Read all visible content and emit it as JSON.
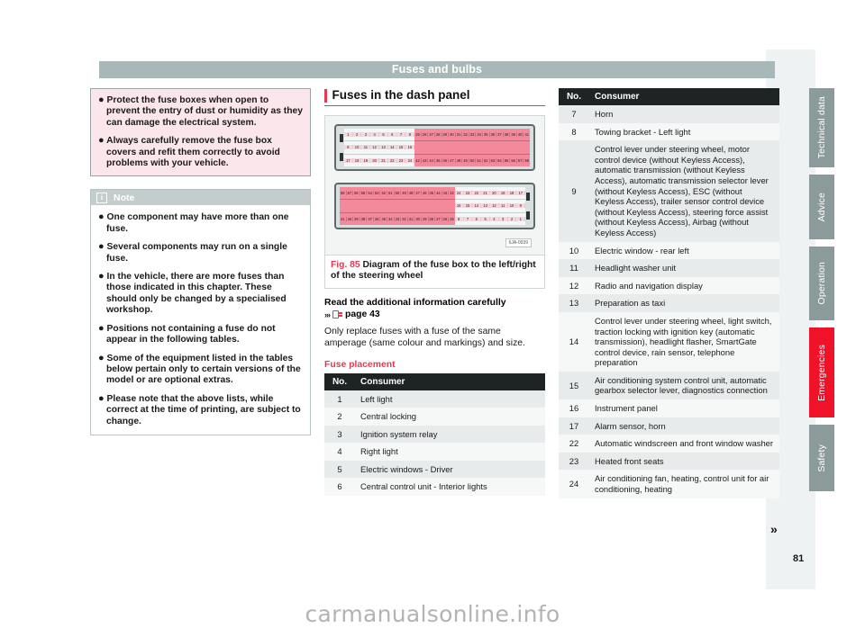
{
  "header": {
    "chapter_title": "Fuses and bulbs"
  },
  "warning": {
    "items": [
      "Protect the fuse boxes when open to prevent the entry of dust or humidity as they can damage the electrical system.",
      "Always carefully remove the fuse box covers and refit them correctly to avoid problems with your vehicle."
    ]
  },
  "note": {
    "icon": "info-icon",
    "title": "Note",
    "items": [
      "One component may have more than one fuse.",
      "Several components may run on a single fuse.",
      "In the vehicle, there are more fuses than those indicated in this chapter. These should only be changed by a specialised workshop.",
      "Positions not containing a fuse do not appear in the following tables.",
      "Some of the equipment listed in the tables below pertain only to certain versions of the model or are optional extras.",
      "Please note that the above lists, while correct at the time of printing, are subject to change."
    ]
  },
  "middle": {
    "section_title": "Fuses in the dash panel",
    "figure": {
      "id_code": "6JA-0039",
      "fig_number": "Fig. 85",
      "caption": "Diagram of the fuse box to the left/right of the steering wheel",
      "box_top": {
        "white_rows": [
          [
            "1",
            "2",
            "3",
            "4",
            "5",
            "6",
            "7",
            "8"
          ],
          [
            "9",
            "10",
            "11",
            "12",
            "13",
            "14",
            "15",
            "16"
          ],
          [
            "17",
            "18",
            "19",
            "20",
            "21",
            "22",
            "23",
            "24"
          ]
        ],
        "pink_rows": [
          [
            "25",
            "26",
            "27",
            "28",
            "29",
            "30",
            "31",
            "32",
            "33",
            "34",
            "35",
            "36",
            "37",
            "38",
            "39",
            "40",
            "41"
          ],
          [
            "",
            "",
            "",
            "",
            "",
            "",
            "",
            "",
            "",
            "",
            "",
            "",
            "",
            "",
            "",
            "",
            ""
          ],
          [
            "42",
            "43",
            "44",
            "45",
            "46",
            "47",
            "48",
            "49",
            "50",
            "51",
            "52",
            "53",
            "54",
            "55",
            "56",
            "57",
            "58"
          ]
        ]
      },
      "box_bottom": {
        "pink_rows": [
          [
            "58",
            "57",
            "56",
            "55",
            "54",
            "53",
            "52",
            "51",
            "50",
            "49",
            "48",
            "47",
            "46",
            "45",
            "44",
            "43",
            "42"
          ],
          [
            "",
            "",
            "",
            "",
            "",
            "",
            "",
            "",
            "",
            "",
            "",
            "",
            "",
            "",
            "",
            "",
            ""
          ],
          [
            "41",
            "40",
            "39",
            "38",
            "37",
            "36",
            "35",
            "34",
            "33",
            "32",
            "31",
            "30",
            "29",
            "28",
            "27",
            "26",
            "25"
          ]
        ],
        "white_rows": [
          [
            "24",
            "23",
            "22",
            "21",
            "20",
            "19",
            "18",
            "17"
          ],
          [
            "16",
            "15",
            "14",
            "13",
            "12",
            "11",
            "10",
            "9"
          ],
          [
            "8",
            "7",
            "6",
            "5",
            "4",
            "3",
            "2",
            "1"
          ]
        ]
      }
    },
    "read_heading": "Read the additional information carefully",
    "reference": {
      "chevron": "»›",
      "icon": "book-page-icon",
      "page_label": "page 43"
    },
    "paragraph": "Only replace fuses with a fuse of the same amperage (same colour and markings) and size.",
    "sub_heading": "Fuse placement",
    "table": {
      "columns": [
        "No.",
        "Consumer"
      ],
      "rows": [
        {
          "no": "1",
          "consumer": "Left light"
        },
        {
          "no": "2",
          "consumer": "Central locking"
        },
        {
          "no": "3",
          "consumer": "Ignition system relay"
        },
        {
          "no": "4",
          "consumer": "Right light"
        },
        {
          "no": "5",
          "consumer": "Electric windows - Driver"
        },
        {
          "no": "6",
          "consumer": "Central control unit - Interior lights"
        }
      ]
    }
  },
  "right": {
    "table": {
      "columns": [
        "No.",
        "Consumer"
      ],
      "rows": [
        {
          "no": "7",
          "consumer": "Horn"
        },
        {
          "no": "8",
          "consumer": "Towing bracket - Left light"
        },
        {
          "no": "9",
          "consumer": "Control lever under steering wheel, motor control device (without Keyless Access), automatic transmission (without Keyless Access), automatic transmission selector lever (without Keyless Access), ESC (without Keyless Access), trailer sensor control device (without Keyless Access), steering force assist (without Keyless Access), Airbag (without Keyless Access)"
        },
        {
          "no": "10",
          "consumer": "Electric window - rear left"
        },
        {
          "no": "11",
          "consumer": "Headlight washer unit"
        },
        {
          "no": "12",
          "consumer": "Radio and navigation display"
        },
        {
          "no": "13",
          "consumer": "Preparation as taxi"
        },
        {
          "no": "14",
          "consumer": "Control lever under steering wheel, light switch, traction locking with ignition key (automatic transmission), headlight flasher, SmartGate control device, rain sensor, telephone preparation"
        },
        {
          "no": "15",
          "consumer": "Air conditioning system control unit, automatic gearbox selector lever, diagnostics connection"
        },
        {
          "no": "16",
          "consumer": "Instrument panel"
        },
        {
          "no": "17",
          "consumer": "Alarm sensor, horn"
        },
        {
          "no": "22",
          "consumer": "Automatic windscreen and front window washer"
        },
        {
          "no": "23",
          "consumer": "Heated front seats"
        },
        {
          "no": "24",
          "consumer": "Air conditioning fan, heating, control unit for air conditioning, heating"
        }
      ]
    },
    "continuation_arrow": "»"
  },
  "sidebar_tabs": [
    {
      "label": "Technical data",
      "active": false
    },
    {
      "label": "Advice",
      "active": false
    },
    {
      "label": "Operation",
      "active": false
    },
    {
      "label": "Emergencies",
      "active": true
    },
    {
      "label": "Safety",
      "active": false
    }
  ],
  "page_number": "81",
  "watermark": "carmanualsonline.info",
  "colors": {
    "accent_red": "#e8384f",
    "tab_active": "#f01228",
    "tab_inactive": "#8b9a9a",
    "header_bar": "#a8b8b8",
    "table_header": "#1e2323",
    "fuse_pink": "#f4899b"
  }
}
